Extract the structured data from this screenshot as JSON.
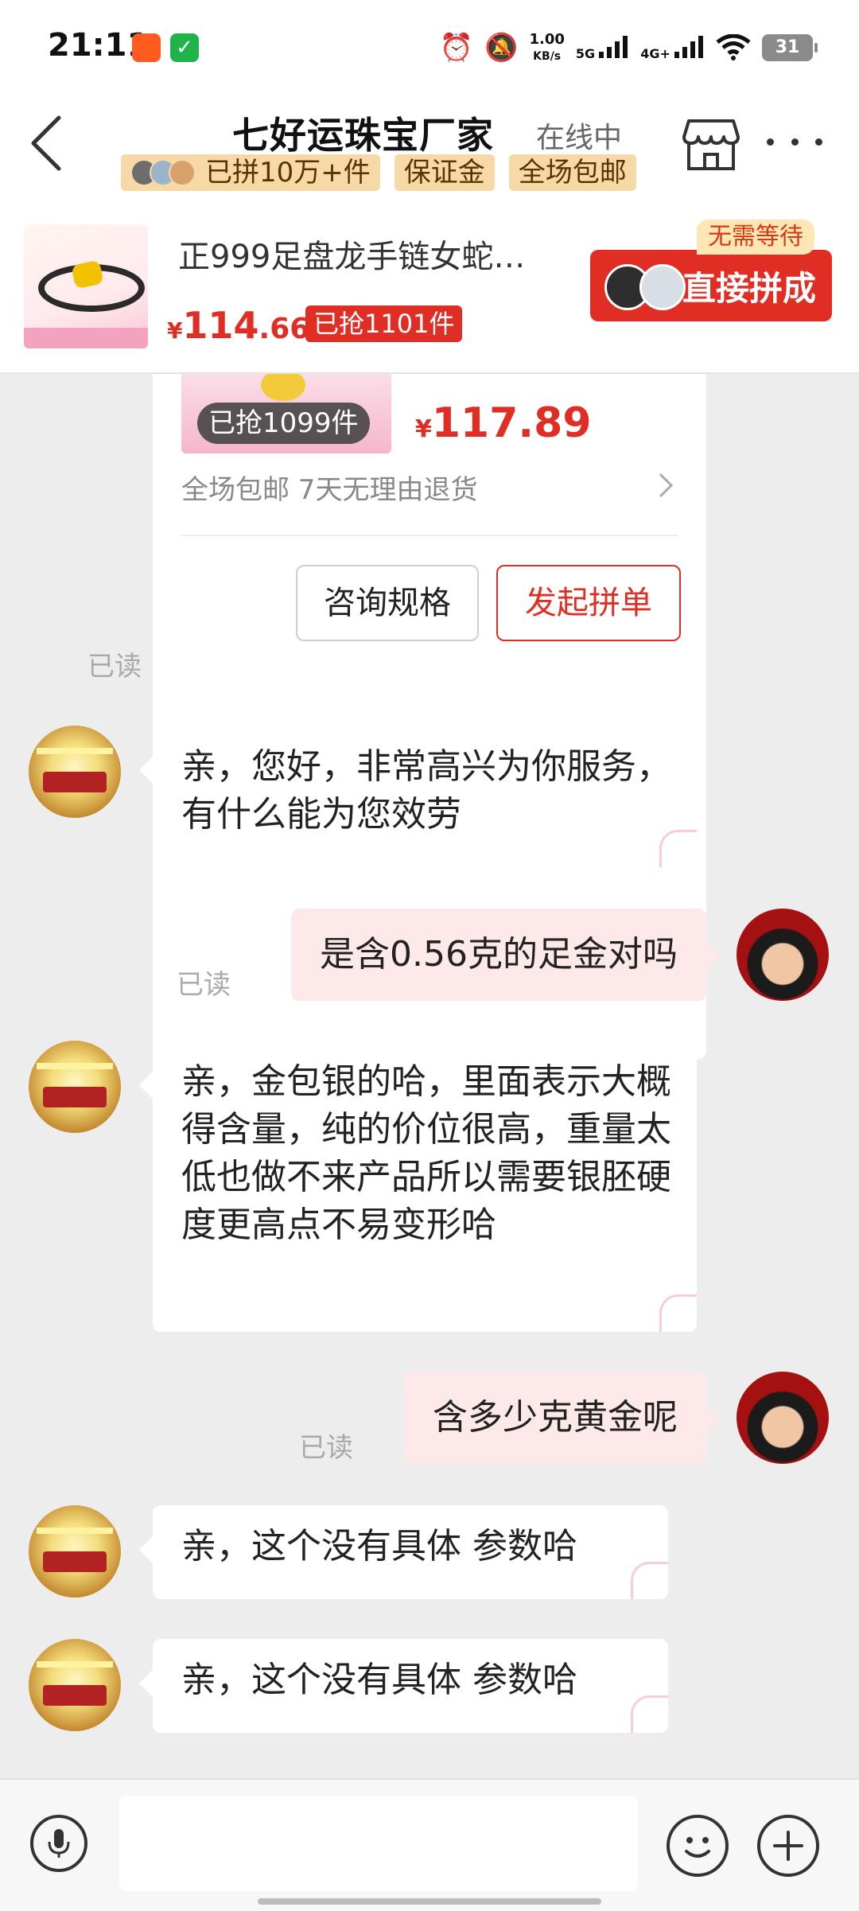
{
  "status_bar": {
    "time": "21:11",
    "speed_value": "1.00",
    "speed_unit": "KB/s",
    "net1": "5G",
    "net2": "4G+",
    "battery": "31",
    "icons": [
      "alarm-icon",
      "mute-icon",
      "signal-icon",
      "wifi-icon",
      "battery-icon"
    ]
  },
  "header": {
    "title": "七好运珠宝厂家",
    "status": "在线中",
    "badges": [
      "已拼10万+件",
      "保证金",
      "全场包邮"
    ],
    "icons": [
      "back-icon",
      "store-icon",
      "more-icon"
    ]
  },
  "product": {
    "title": "正999足盘龙手链女蛇…",
    "price_currency": "¥",
    "price_int": "114",
    "price_dec": ".66",
    "sold": "已抢1101件",
    "direct_button": "直接拼成",
    "no_wait_tag": "无需等待"
  },
  "card": {
    "sold_badge": "已抢1099件",
    "price_currency": "¥",
    "price": "117.89",
    "info": "全场包邮 7天无理由退货",
    "consult_button": "咨询规格",
    "group_button": "发起拼单",
    "read": "已读"
  },
  "messages": [
    {
      "from": "shop",
      "text": "亲，您好，非常高兴为你服务，有什么能为您效劳"
    },
    {
      "from": "user",
      "text": "是含0.56克的足金对吗",
      "read": "已读"
    },
    {
      "from": "shop",
      "text": "亲，金包银的哈，里面表示大概得含量，纯的价位很高，重量太低也做不来产品所以需要银胚硬度更高点不易变形哈"
    },
    {
      "from": "user",
      "text": "含多少克黄金呢",
      "read": "已读"
    },
    {
      "from": "shop",
      "text": "亲，这个没有具体 参数哈"
    },
    {
      "from": "shop",
      "text": "亲，这个没有具体 参数哈"
    }
  ],
  "input": {
    "placeholder": "",
    "icons": [
      "microphone-icon",
      "emoji-icon",
      "plus-icon"
    ]
  },
  "colors": {
    "accent": "#e02e24",
    "badge_bg": "#f6d9a6",
    "user_bubble": "#fde9e9",
    "chat_bg": "#ededed"
  }
}
